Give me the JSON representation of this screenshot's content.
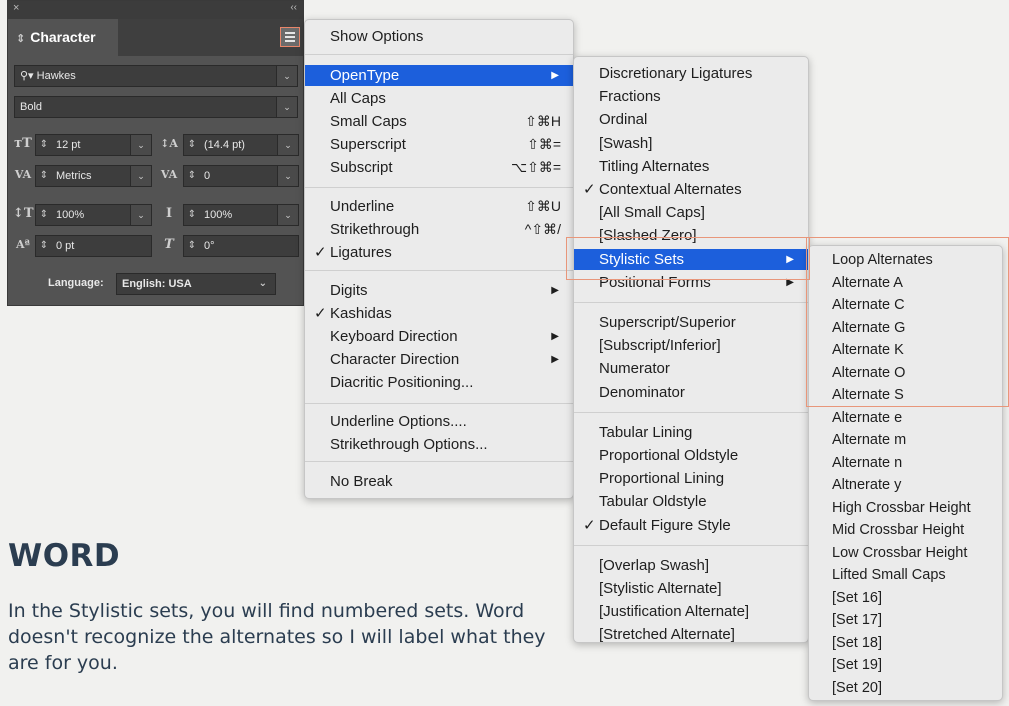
{
  "panel": {
    "close_glyph": "×",
    "collapse_glyph": "‹‹",
    "tab_label": "Character",
    "font_family": "Hawkes",
    "font_style": "Bold",
    "font_size": "12 pt",
    "leading": "(14.4 pt)",
    "kerning": "Metrics",
    "tracking": "0",
    "vertical_scale": "100%",
    "horizontal_scale": "100%",
    "baseline_shift": "0 pt",
    "skew": "0°",
    "language_label": "Language:",
    "language_value": "English: USA"
  },
  "main_menu": {
    "items": [
      {
        "label": "Show Options"
      },
      {
        "label": "OpenType",
        "submenu": true,
        "highlighted": true
      },
      {
        "label": "All Caps"
      },
      {
        "label": "Small Caps",
        "shortcut": "⇧⌘H"
      },
      {
        "label": "Superscript",
        "shortcut": "⇧⌘="
      },
      {
        "label": "Subscript",
        "shortcut": "⌥⇧⌘="
      },
      {
        "label": "Underline",
        "shortcut": "⇧⌘U"
      },
      {
        "label": "Strikethrough",
        "shortcut": "^⇧⌘/"
      },
      {
        "label": "Ligatures",
        "checked": true
      },
      {
        "label": "Digits",
        "submenu": true
      },
      {
        "label": "Kashidas",
        "checked": true
      },
      {
        "label": "Keyboard Direction",
        "submenu": true
      },
      {
        "label": "Character Direction",
        "submenu": true
      },
      {
        "label": "Diacritic Positioning..."
      },
      {
        "label": "Underline Options...."
      },
      {
        "label": "Strikethrough Options..."
      },
      {
        "label": "No Break"
      }
    ]
  },
  "opentype_menu": {
    "items": [
      {
        "label": "Discretionary Ligatures"
      },
      {
        "label": "Fractions"
      },
      {
        "label": "Ordinal"
      },
      {
        "label": "[Swash]"
      },
      {
        "label": "Titling Alternates"
      },
      {
        "label": "Contextual Alternates",
        "checked": true
      },
      {
        "label": "[All Small Caps]"
      },
      {
        "label": "[Slashed Zero]"
      },
      {
        "label": "Stylistic Sets",
        "submenu": true,
        "highlighted": true
      },
      {
        "label": "Positional Forms",
        "submenu": true
      },
      {
        "label": "Superscript/Superior"
      },
      {
        "label": "[Subscript/Inferior]"
      },
      {
        "label": "Numerator"
      },
      {
        "label": "Denominator"
      },
      {
        "label": "Tabular Lining"
      },
      {
        "label": "Proportional Oldstyle"
      },
      {
        "label": "Proportional Lining"
      },
      {
        "label": "Tabular Oldstyle"
      },
      {
        "label": "Default Figure Style",
        "checked": true
      },
      {
        "label": "[Overlap Swash]"
      },
      {
        "label": "[Stylistic Alternate]"
      },
      {
        "label": "[Justification Alternate]"
      },
      {
        "label": "[Stretched Alternate]"
      }
    ]
  },
  "stylistic_sets": {
    "items": [
      "Loop Alternates",
      "Alternate A",
      "Alternate C",
      "Alternate G",
      "Alternate K",
      "Alternate O",
      "Alternate S",
      "Alternate e",
      "Alternate m",
      "Alternate n",
      "Altnerate y",
      "High Crossbar Height",
      "Mid Crossbar Height",
      "Low Crossbar Height",
      "Lifted Small Caps",
      "[Set 16]",
      "[Set 17]",
      "[Set 18]",
      "[Set 19]",
      "[Set 20]"
    ]
  },
  "glyphs": {
    "check": "✓",
    "arrow": "▶"
  },
  "heading": "WORD",
  "paragraph": "In the Stylistic sets, you will find numbered sets. Word doesn't recognize the alternates so I will label what they are for you.",
  "colors": {
    "highlight": "#1c5fdc",
    "annotation_box": "#e8967a",
    "heading_text": "#2b3d50"
  }
}
